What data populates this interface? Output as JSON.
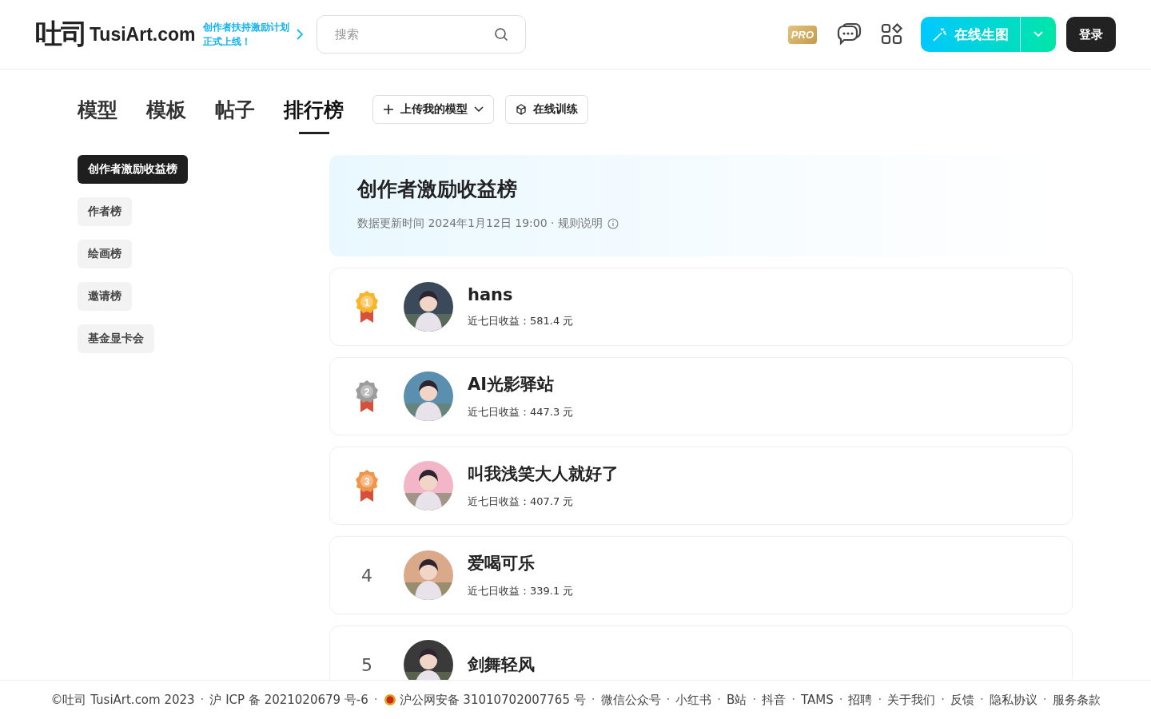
{
  "header": {
    "logo_cn": "吐司",
    "logo_en": "TusiArt.com",
    "promo_lines": [
      "创作者扶持激励计划",
      "正式上线！"
    ],
    "search": {
      "placeholder": "搜索"
    },
    "pro_badge": "PRO",
    "generate_button": "在线生图",
    "login_button": "登录"
  },
  "tabs": [
    {
      "label": "模型",
      "selected": false
    },
    {
      "label": "模板",
      "selected": false
    },
    {
      "label": "帖子",
      "selected": false
    },
    {
      "label": "排行榜",
      "selected": true
    }
  ],
  "actions": [
    {
      "kind": "upload",
      "label": "上传我的模型"
    },
    {
      "kind": "train",
      "label": "在线训练"
    }
  ],
  "sidebar": {
    "items": [
      {
        "label": "创作者激励收益榜",
        "selected": true
      },
      {
        "label": "作者榜",
        "selected": false
      },
      {
        "label": "绘画榜",
        "selected": false
      },
      {
        "label": "邀请榜",
        "selected": false
      },
      {
        "label": "基金显卡会",
        "selected": false
      }
    ]
  },
  "banner": {
    "title": "创作者激励收益榜",
    "subtitle": "数据更新时间 2024年1月12日 19:00 · 规则说明"
  },
  "ranking": [
    {
      "kind": "medal",
      "rank": "1",
      "color": "#f7b52c",
      "name": "hans",
      "income": "近七日收益：581.4 元"
    },
    {
      "kind": "medal",
      "rank": "2",
      "color": "#9c9c9c",
      "name": "AI光影驿站",
      "income": "近七日收益：447.3 元"
    },
    {
      "kind": "medal",
      "rank": "3",
      "color": "#f0964a",
      "name": "叫我浅笑大人就好了",
      "income": "近七日收益：407.7 元"
    },
    {
      "kind": "number",
      "rank": "4",
      "name": "爱喝可乐",
      "income": "近七日收益：339.1 元"
    },
    {
      "kind": "number",
      "rank": "5",
      "name": "剑舞轻风"
    }
  ],
  "footer": {
    "separator": "·",
    "items": [
      {
        "kind": "text",
        "label": "©吐司 TusiArt.com 2023"
      },
      {
        "kind": "link",
        "label": "沪 ICP 备 2021020679 号-6"
      },
      {
        "kind": "police",
        "label": "沪公网安备 31010702007765 号"
      },
      {
        "kind": "link",
        "label": "微信公众号"
      },
      {
        "kind": "link",
        "label": "小红书"
      },
      {
        "kind": "link",
        "label": "B站"
      },
      {
        "kind": "link",
        "label": "抖音"
      },
      {
        "kind": "link",
        "label": "TAMS"
      },
      {
        "kind": "link",
        "label": "招聘"
      },
      {
        "kind": "link",
        "label": "关于我们"
      },
      {
        "kind": "link",
        "label": "反馈"
      },
      {
        "kind": "link",
        "label": "隐私协议"
      },
      {
        "kind": "link",
        "label": "服务条款"
      }
    ]
  }
}
